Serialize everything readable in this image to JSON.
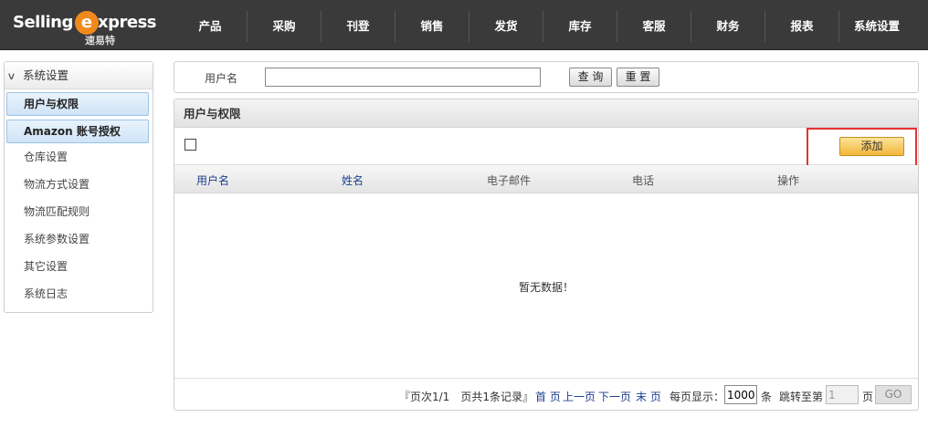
{
  "logo": {
    "word1": "Selling",
    "e_letter": "e",
    "word2": "xpress",
    "subtitle": "速易特"
  },
  "nav": [
    "产品",
    "采购",
    "刊登",
    "销售",
    "发货",
    "库存",
    "客服",
    "财务",
    "报表",
    "系统设置"
  ],
  "sidebar": {
    "header": "系统设置",
    "items": [
      {
        "label": "用户与权限",
        "active": true
      },
      {
        "label": "Amazon 账号授权",
        "active": true
      },
      {
        "label": "仓库设置",
        "active": false
      },
      {
        "label": "物流方式设置",
        "active": false
      },
      {
        "label": "物流匹配规则",
        "active": false
      },
      {
        "label": "系统参数设置",
        "active": false
      },
      {
        "label": "其它设置",
        "active": false
      },
      {
        "label": "系统日志",
        "active": false
      }
    ]
  },
  "search": {
    "label": "用户名",
    "value": "",
    "query_button": "查 询",
    "reset_button": "重 置"
  },
  "panel": {
    "title": "用户与权限",
    "add_button": "添加",
    "columns": [
      {
        "label": "用户名",
        "link": true
      },
      {
        "label": "姓名",
        "link": true
      },
      {
        "label": "电子邮件",
        "link": false
      },
      {
        "label": "电话",
        "link": false
      },
      {
        "label": "操作",
        "link": false
      }
    ],
    "empty_message": "暂无数据！"
  },
  "pager": {
    "summary": "『页次1/1　页共1条记录』",
    "first": "首 页",
    "prev": "上一页",
    "next": "下一页",
    "last": "末 页",
    "per_page_label": "每页显示：",
    "per_page_value": "1000",
    "per_page_unit": "条",
    "jump_label": "跳转至第",
    "jump_value": "1",
    "jump_unit": "页",
    "go_button": "GO"
  },
  "colors": {
    "topbar": "#3a3a3a",
    "accent_orange": "#f08a1c",
    "link_blue": "#1d3f8f",
    "highlight_red": "#e53333",
    "add_button": "#f1b73a"
  }
}
